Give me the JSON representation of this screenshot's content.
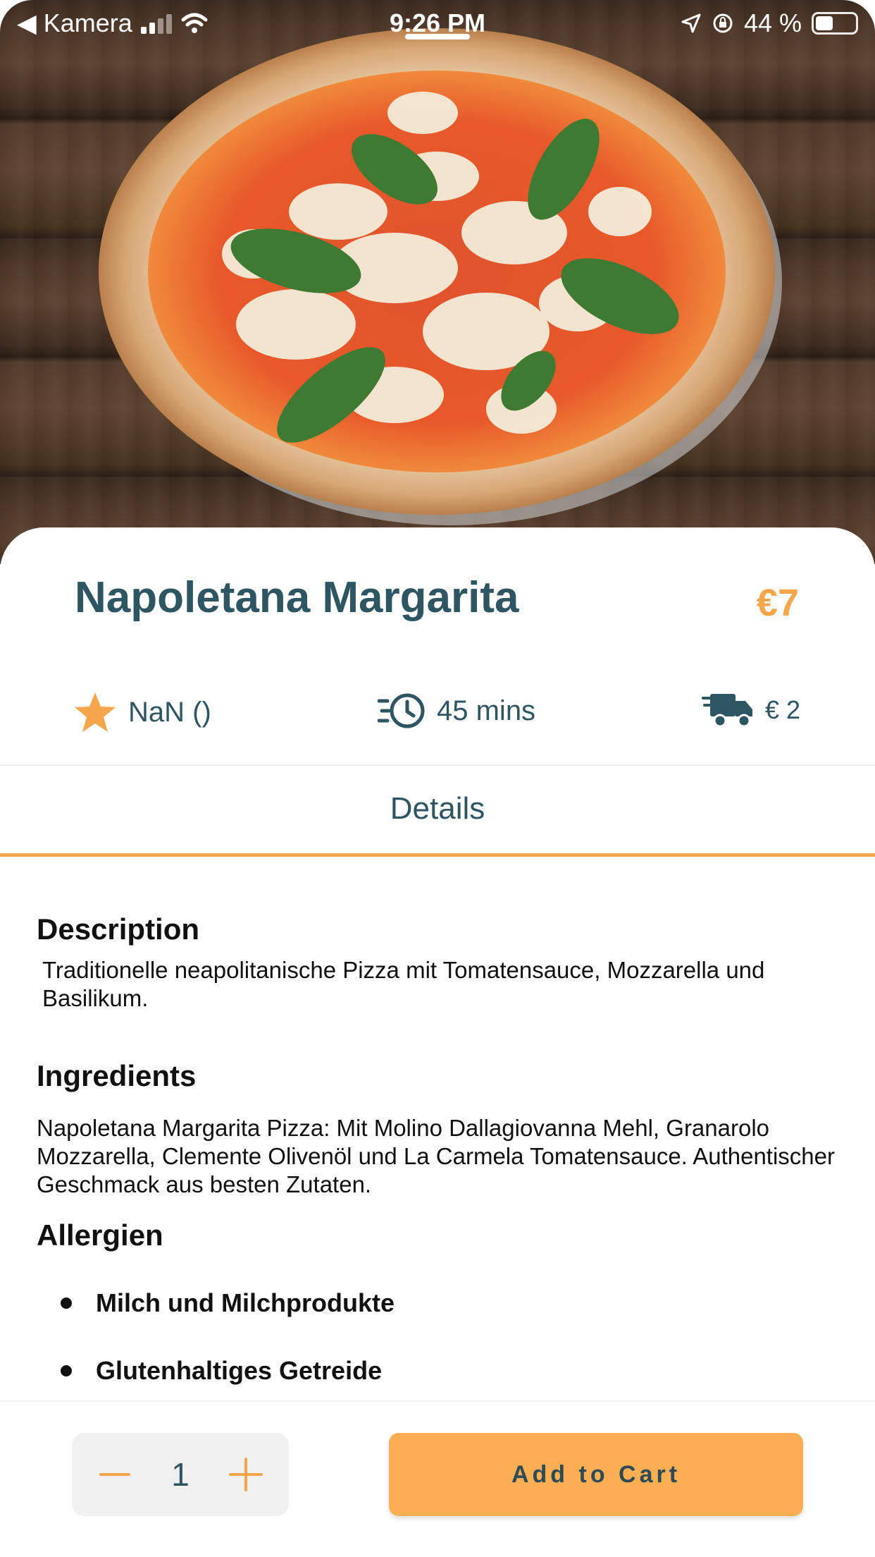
{
  "status_bar": {
    "back_app": "Kamera",
    "time": "9:26 PM",
    "battery_text": "44 %",
    "battery_level": 0.44
  },
  "product": {
    "image_icon": "pizza-image",
    "name": "Napoletana Margarita",
    "price": "€7"
  },
  "info": {
    "rating": "NaN ()",
    "rating_icon": "star-icon",
    "time": "45 mins",
    "time_icon": "fast-clock-icon",
    "delivery_fee": "€ 2",
    "delivery_icon": "delivery-truck-icon"
  },
  "tabs": {
    "details": "Details"
  },
  "sections": {
    "description_heading": "Description",
    "description_text": "Traditionelle neapolitanische Pizza mit Tomatensauce, Mozzarella und Basilikum.",
    "ingredients_heading": "Ingredients",
    "ingredients_text": "Napoletana Margarita Pizza: Mit Molino Dallagiovanna Mehl, Granarolo Mozzarella, Clemente Olivenöl und La Carmela Tomatensauce. Authentischer Geschmack aus besten Zutaten.",
    "allergens_heading": "Allergien",
    "allergens": [
      "Milch und Milchprodukte",
      "Glutenhaltiges Getreide"
    ]
  },
  "cart": {
    "quantity": "1",
    "add_label": "Add to Cart"
  },
  "colors": {
    "accent": "#f5a54a",
    "title": "#2e5562",
    "button": "#fcae52"
  }
}
